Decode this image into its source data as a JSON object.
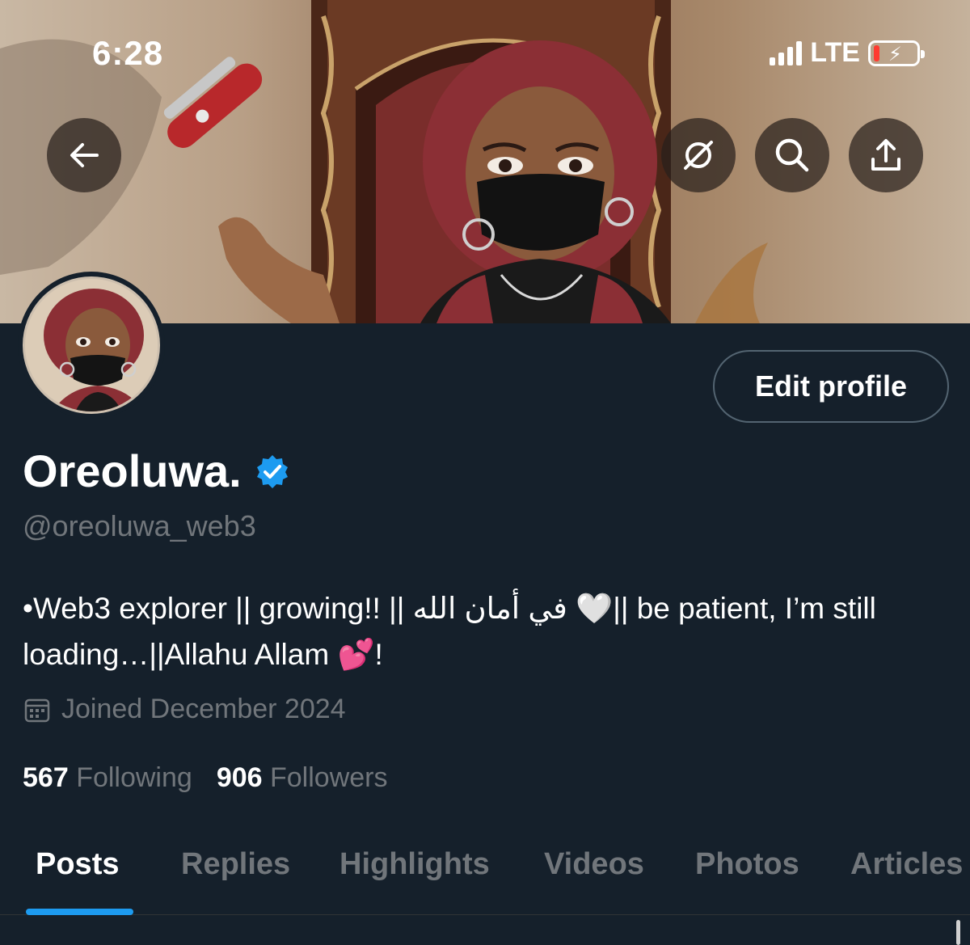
{
  "status_bar": {
    "time": "6:28",
    "network": "LTE"
  },
  "header": {
    "back_icon": "arrow-left-icon",
    "grok_icon": "grok-icon",
    "search_icon": "search-icon",
    "share_icon": "share-icon"
  },
  "profile": {
    "name": "Oreoluwa.",
    "handle": "@oreoluwa_web3",
    "verified": true,
    "edit_label": "Edit profile",
    "bio": "•Web3 explorer || growing!! || في أمان الله 🤍|| be patient, I’m still loading…||Allahu Allam 💕!",
    "joined": "Joined December 2024",
    "following_count": "567",
    "following_label": "Following",
    "followers_count": "906",
    "followers_label": "Followers"
  },
  "tabs": [
    "Posts",
    "Replies",
    "Highlights",
    "Videos",
    "Photos",
    "Articles"
  ],
  "colors": {
    "accent": "#1d9bf0",
    "background": "#15202b",
    "muted": "#71767b"
  }
}
